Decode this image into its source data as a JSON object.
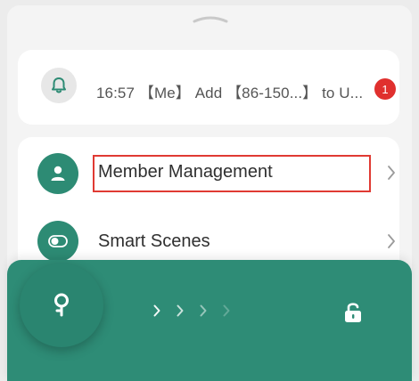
{
  "colors": {
    "accent": "#2d8b74",
    "badge": "#e0302e",
    "highlight": "#e03a33"
  },
  "notification": {
    "icon": "bell-icon",
    "text": "16:57 【Me】 Add 【86-150...】 to U...",
    "badge_count": "1"
  },
  "menu": {
    "items": [
      {
        "label": "Member Management",
        "icon": "user-icon"
      },
      {
        "label": "Smart Scenes",
        "icon": "toggle-icon"
      }
    ]
  },
  "unlock_bar": {
    "key_icon": "key-icon",
    "lock_icon": "unlock-icon"
  }
}
